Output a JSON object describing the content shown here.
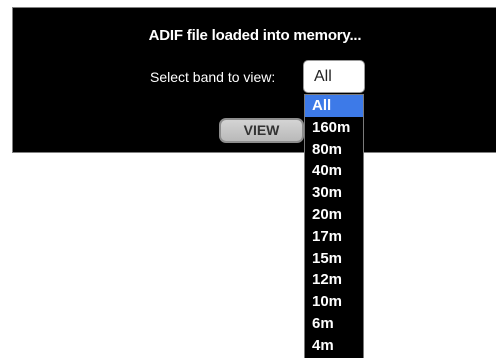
{
  "panel": {
    "title": "ADIF file loaded into memory...",
    "band_label": "Select band to view:",
    "band_select": {
      "value": "All",
      "options": [
        "All",
        "160m",
        "80m",
        "40m",
        "30m",
        "20m",
        "17m",
        "15m",
        "12m",
        "10m",
        "6m",
        "4m"
      ],
      "highlighted": "All"
    },
    "view_button_label": "VIEW"
  },
  "colors": {
    "panel_background": "#000000",
    "highlight": "#3d7ae8",
    "text": "#ffffff"
  }
}
